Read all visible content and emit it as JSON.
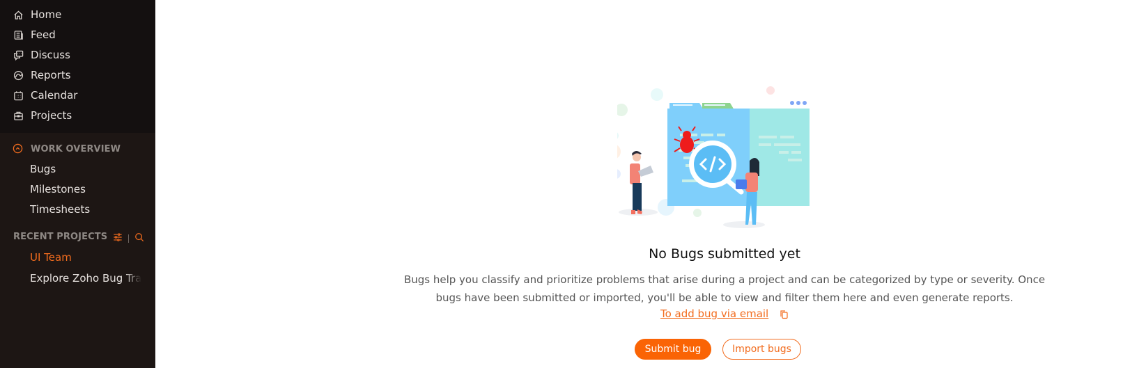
{
  "sidebar": {
    "nav": [
      {
        "label": "Home",
        "icon": "home-icon"
      },
      {
        "label": "Feed",
        "icon": "feed-icon"
      },
      {
        "label": "Discuss",
        "icon": "discuss-icon"
      },
      {
        "label": "Reports",
        "icon": "reports-icon"
      },
      {
        "label": "Calendar",
        "icon": "calendar-icon"
      },
      {
        "label": "Projects",
        "icon": "projects-icon"
      }
    ],
    "work_overview": {
      "heading": "WORK OVERVIEW",
      "items": [
        {
          "label": "Bugs"
        },
        {
          "label": "Milestones"
        },
        {
          "label": "Timesheets"
        }
      ]
    },
    "recent_projects": {
      "heading": "RECENT PROJECTS",
      "items": [
        {
          "label": "UI Team",
          "active": true
        },
        {
          "label": "Explore Zoho Bug Tracker",
          "active": false
        }
      ]
    }
  },
  "empty_state": {
    "title": "No Bugs submitted yet",
    "description_line1": "Bugs help you classify and prioritize problems that arise during a project and can be categorized by type or severity. Once",
    "description_line2": "bugs have been submitted or imported, you'll be able to view and filter them here and even generate reports.",
    "email_link": "To add bug via email",
    "submit_button": "Submit bug",
    "import_button": "Import bugs"
  },
  "colors": {
    "accent": "#f26c1e",
    "button_primary": "#fa6405",
    "sidebar_bg": "#1d1614",
    "sidebar_top_bg": "#141010"
  }
}
